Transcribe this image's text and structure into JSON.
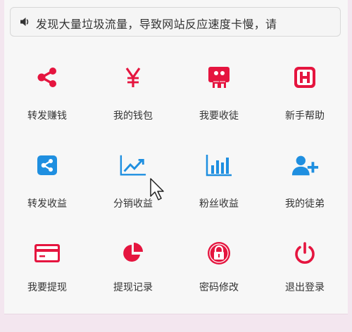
{
  "notice": {
    "text": "发现大量垃圾流量，导致网站反应速度卡慢，请"
  },
  "colors": {
    "red": "#e5153f",
    "blue": "#1f8fe0",
    "text": "#333333"
  },
  "menu": [
    {
      "label": "转发赚钱",
      "icon": "share-nodes-icon"
    },
    {
      "label": "我的钱包",
      "icon": "yen-icon"
    },
    {
      "label": "我要收徒",
      "icon": "recruit-icon"
    },
    {
      "label": "新手帮助",
      "icon": "help-h-icon"
    },
    {
      "label": "转发收益",
      "icon": "share-box-icon"
    },
    {
      "label": "分销收益",
      "icon": "line-chart-icon"
    },
    {
      "label": "粉丝收益",
      "icon": "bar-chart-icon"
    },
    {
      "label": "我的徒弟",
      "icon": "add-user-icon"
    },
    {
      "label": "我要提现",
      "icon": "credit-card-icon"
    },
    {
      "label": "提现记录",
      "icon": "pie-chart-icon"
    },
    {
      "label": "密码修改",
      "icon": "lock-icon"
    },
    {
      "label": "退出登录",
      "icon": "power-icon"
    }
  ]
}
